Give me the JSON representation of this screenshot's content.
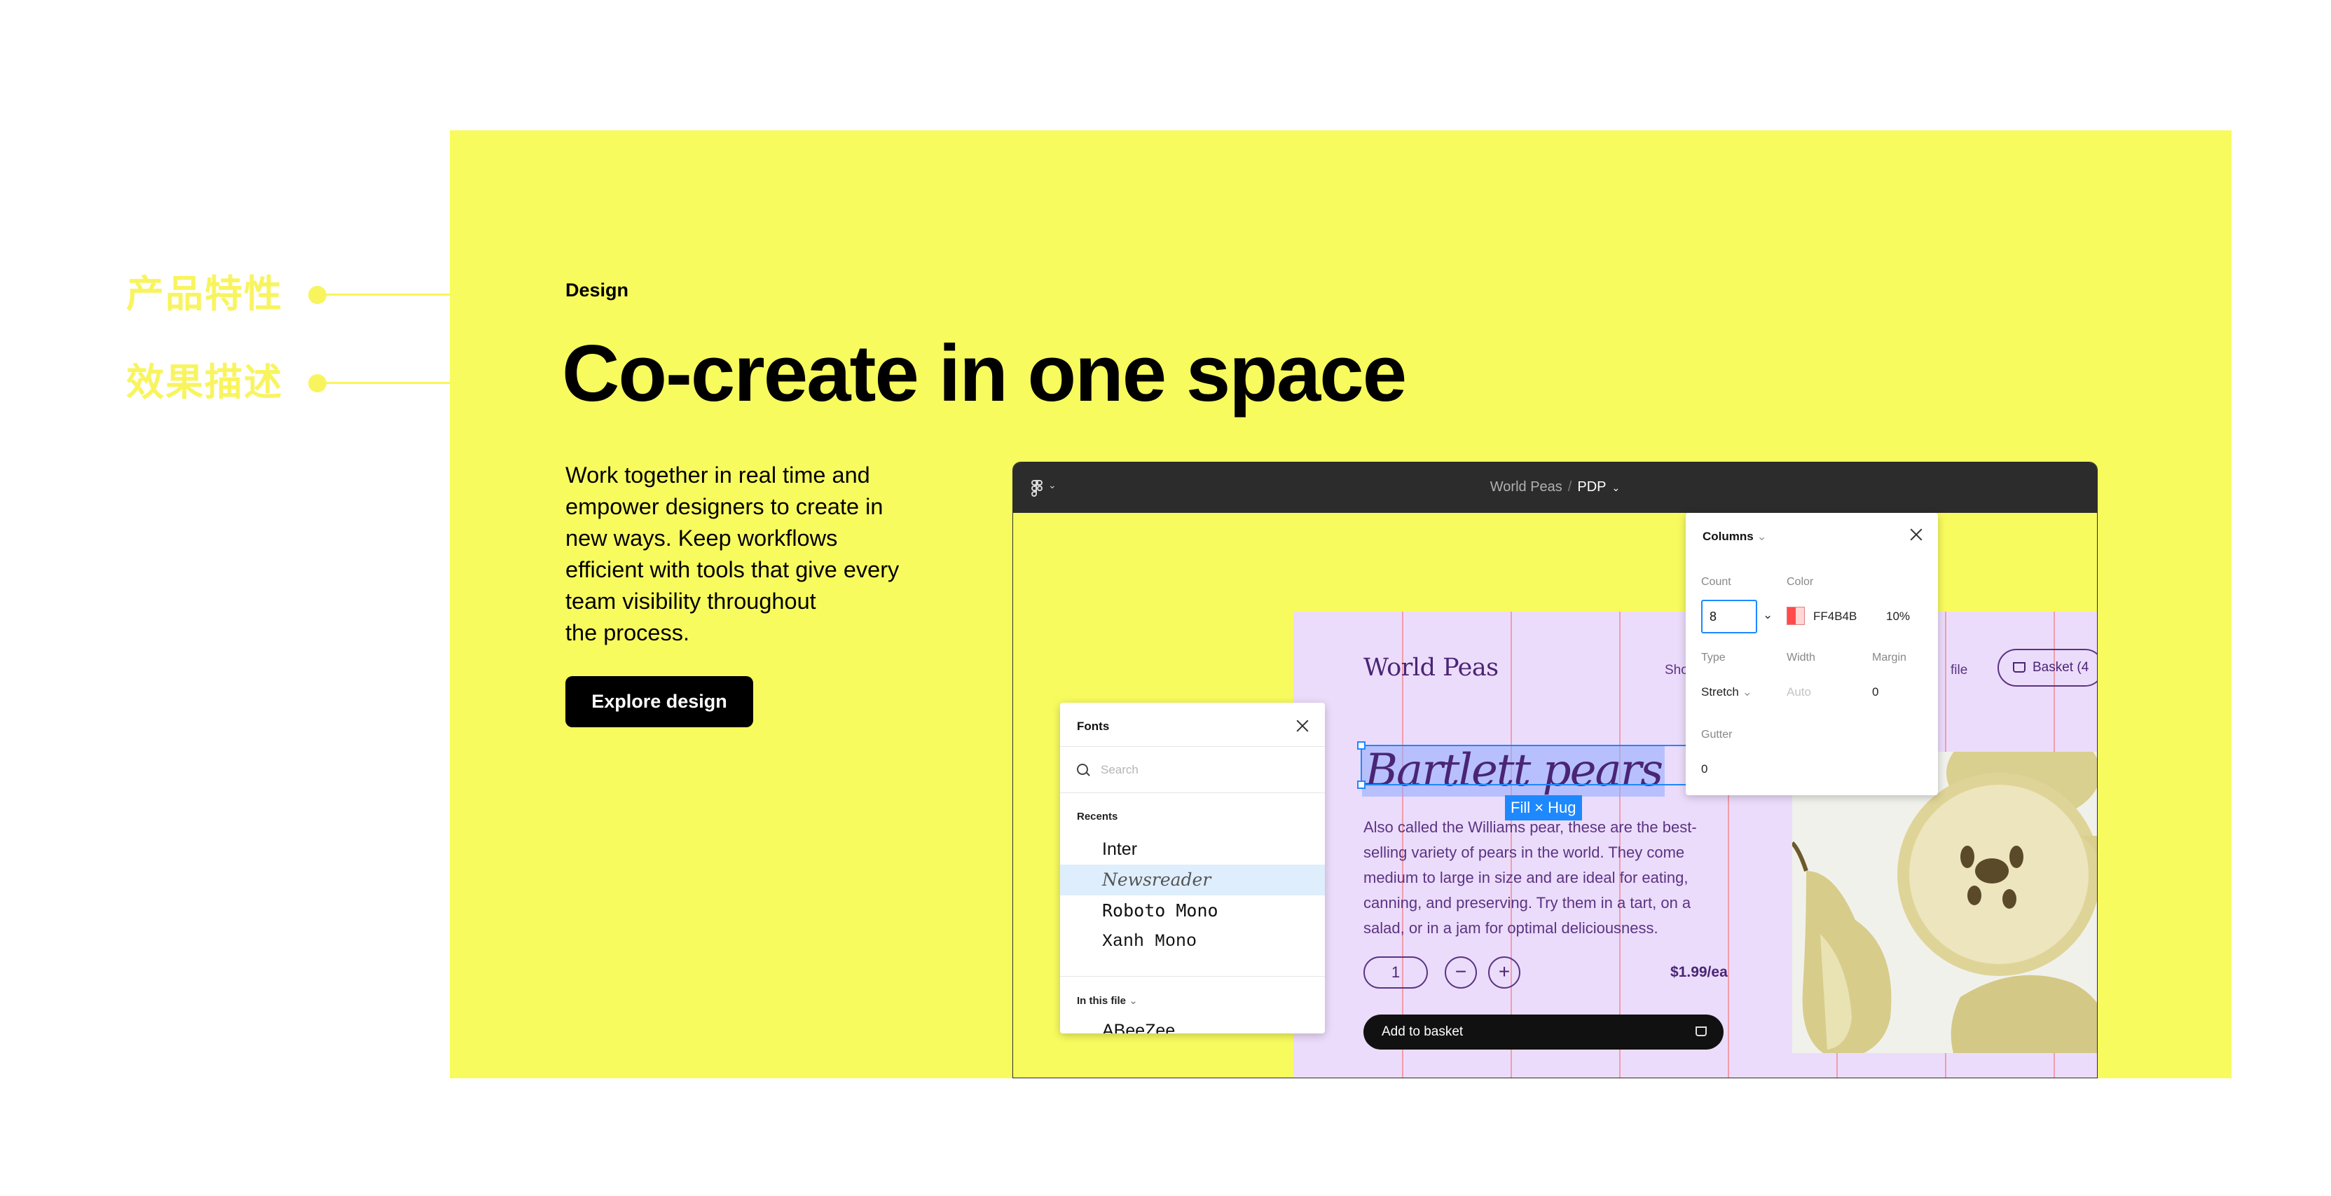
{
  "annotations": [
    {
      "label": "产品特性"
    },
    {
      "label": "效果描述"
    }
  ],
  "hero": {
    "eyebrow": "Design",
    "headline": "Co-create in one space",
    "body_lines": [
      "Work together in real time and",
      "empower designers to create in",
      "new ways. Keep workflows",
      "efficient with tools that give every",
      "team visibility throughout",
      "the process."
    ],
    "cta": "Explore design"
  },
  "editor": {
    "breadcrumb": {
      "project": "World Peas",
      "separator": "/",
      "page": "PDP"
    },
    "frame": {
      "brand": "World Peas",
      "nav": [
        "Shop",
        "file"
      ],
      "basket": "Basket (4",
      "product_title": "Bartlett pears",
      "sizing_badge": "Fill × Hug",
      "description": "Also called the Williams pear, these are the best-selling variety of pears in the world. They come medium to large in size and are ideal for eating, canning, and preserving. Try them in a tart, on a salad, or in a jam for optimal deliciousness.",
      "quantity": "1",
      "minus": "−",
      "plus": "+",
      "price": "$1.99/ea",
      "add_to_basket": "Add to basket"
    }
  },
  "fonts_panel": {
    "title": "Fonts",
    "search_placeholder": "Search",
    "recents_label": "Recents",
    "recents": [
      "Inter",
      "Newsreader",
      "Roboto Mono",
      "Xanh Mono"
    ],
    "selected": "Newsreader",
    "in_file_label": "In this file",
    "in_file_first": "ABeeZee"
  },
  "columns_panel": {
    "title": "Columns",
    "count_label": "Count",
    "count_value": "8",
    "color_label": "Color",
    "color_hex": "FF4B4B",
    "color_opacity": "10%",
    "type_label": "Type",
    "type_value": "Stretch",
    "width_label": "Width",
    "width_value": "Auto",
    "margin_label": "Margin",
    "margin_value": "0",
    "gutter_label": "Gutter",
    "gutter_value": "0"
  },
  "colors": {
    "accent_yellow": "#f8fb5e",
    "annotation_yellow": "#f8f45e",
    "frame_purple": "#ecdcfb",
    "text_purple": "#4a2575",
    "selection_blue": "#1e88ff",
    "grid_red": "#ff4b4b"
  }
}
